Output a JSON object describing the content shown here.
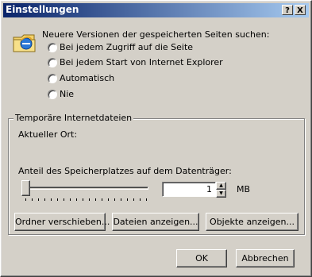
{
  "window": {
    "title": "Einstellungen",
    "help_button": "?",
    "close_button": "X"
  },
  "check_section": {
    "label": "Neuere Versionen der gespeicherten Seiten suchen:",
    "options": [
      {
        "label": "Bei jedem Zugriff auf die Seite",
        "selected": false
      },
      {
        "label": "Bei jedem Start von Internet Explorer",
        "selected": false
      },
      {
        "label": "Automatisch",
        "selected": false
      },
      {
        "label": "Nie",
        "selected": false
      }
    ]
  },
  "temp_files": {
    "group_title": "Temporäre Internetdateien",
    "current_location_label": "Aktueller Ort:",
    "disk_space_label": "Anteil des Speicherplatzes auf dem Datenträger:",
    "size_value": "1",
    "size_unit": "MB",
    "move_folder_button": "Ordner verschieben...",
    "view_files_button": "Dateien anzeigen...",
    "view_objects_button": "Objekte anzeigen..."
  },
  "footer": {
    "ok_button": "OK",
    "cancel_button": "Abbrechen"
  },
  "icons": {
    "ie_icon": "internet-explorer-icon"
  }
}
